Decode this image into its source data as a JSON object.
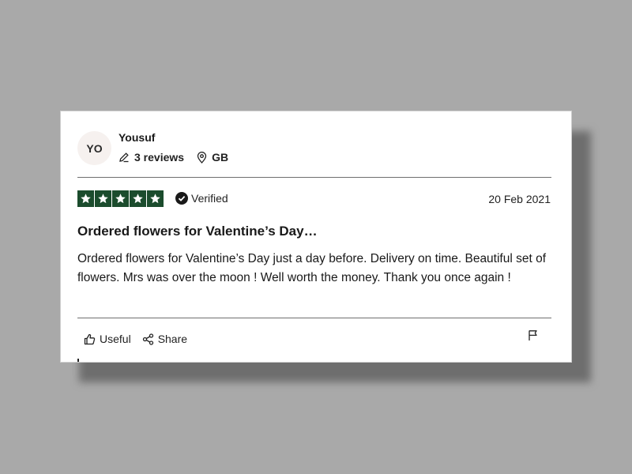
{
  "review": {
    "avatar_initials": "YO",
    "reviewer_name": "Yousuf",
    "review_count": "3 reviews",
    "country": "GB",
    "rating": 5,
    "rating_max": 5,
    "verified_label": "Verified",
    "date": "20 Feb 2021",
    "title": "Ordered flowers for Valentine’s Day…",
    "body": "Ordered flowers for Valentine’s Day just a day before. Delivery on time. Beautiful set of flowers. Mrs was over the moon ! Well worth the money. Thank you once again !"
  },
  "actions": {
    "useful_label": "Useful",
    "share_label": "Share"
  },
  "icons": {
    "reviews": "pencil-icon",
    "country": "location-pin-icon",
    "verified": "check-circle-icon",
    "useful": "thumbs-up-icon",
    "share": "share-icon",
    "report": "flag-icon",
    "star": "star-icon"
  },
  "colors": {
    "background": "#a9a9a9",
    "card": "#ffffff",
    "star_fill": "#1b4c2d",
    "text": "#191919"
  }
}
